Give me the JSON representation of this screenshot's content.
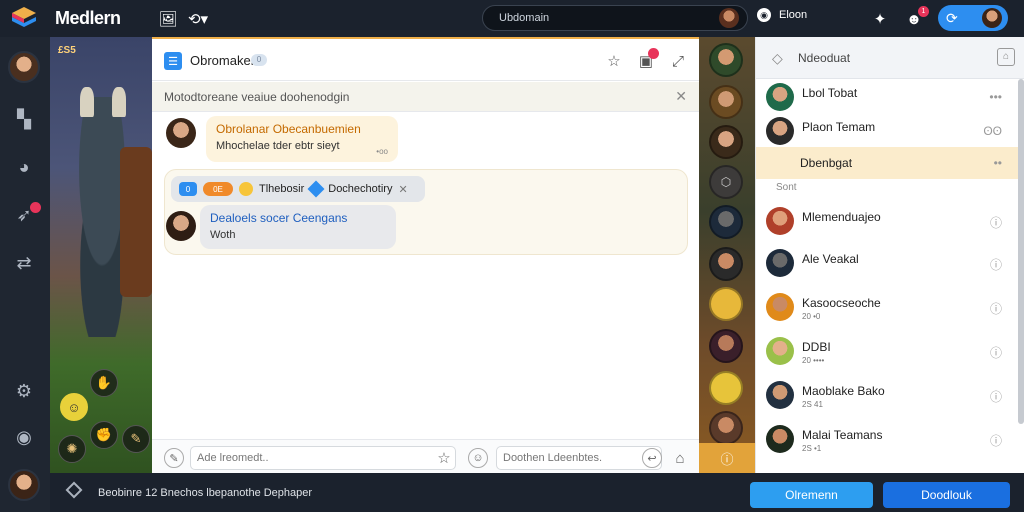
{
  "topbar": {
    "app_title": "Medlern",
    "search_value": "Ubdomain",
    "status_text": "Eloon",
    "notification_count": "1"
  },
  "game": {
    "level_badge": "£S5"
  },
  "chat": {
    "title": "Obromaker",
    "count_pill": "0",
    "notice_text": "Motodtoreane veaiue doohenodgin",
    "message1": {
      "line1": "Obrolanar Obecanbuemien",
      "line2": "Mhochelae tder ebtr sieyt",
      "time": "•oo"
    },
    "group": {
      "tag_blue": "0",
      "tag_orange": "0E",
      "name": "Tlhebosir",
      "sub_name": "Dochechotiry"
    },
    "message2": {
      "line1": "Dealoels socer Ceengans",
      "line2": "Woth"
    },
    "composer_placeholder": "Ade lreomedt..",
    "composer2_placeholder": "Doothen Ldeenbtes."
  },
  "right_panel": {
    "title": "Ndeoduat",
    "section_label": "Sont",
    "rows": [
      {
        "name": "Lbol Tobat",
        "sub": "",
        "meta": "•••"
      },
      {
        "name": "Plaon Temam",
        "sub": "",
        "meta": "ʘʘ"
      },
      {
        "name": "Dbenbgat",
        "sub": "",
        "meta": "••"
      },
      {
        "name": "Mlemenduajeo",
        "sub": "",
        "meta": "ⓘ"
      },
      {
        "name": "Ale Veakal",
        "sub": "",
        "meta": "ⓘ"
      },
      {
        "name": "Kasoocseoche",
        "sub": "20 •0",
        "meta": "ⓘ"
      },
      {
        "name": "DDBI",
        "sub": "20 ••••",
        "meta": "ⓘ"
      },
      {
        "name": "Maoblake Bako",
        "sub": "2S 41",
        "meta": "ⓘ"
      },
      {
        "name": "Malai Teamans",
        "sub": "2S •1",
        "meta": "ⓘ"
      }
    ]
  },
  "bottombar": {
    "status_text": "Beobinre 12 Bnechos lbepanothe Dephaper",
    "btn_secondary": "Olremenn",
    "btn_primary": "Doodlouk"
  },
  "colors": {
    "accent_blue": "#2d8ef0",
    "accent_orange": "#e2a33a",
    "dark_bg": "#1b222d"
  }
}
